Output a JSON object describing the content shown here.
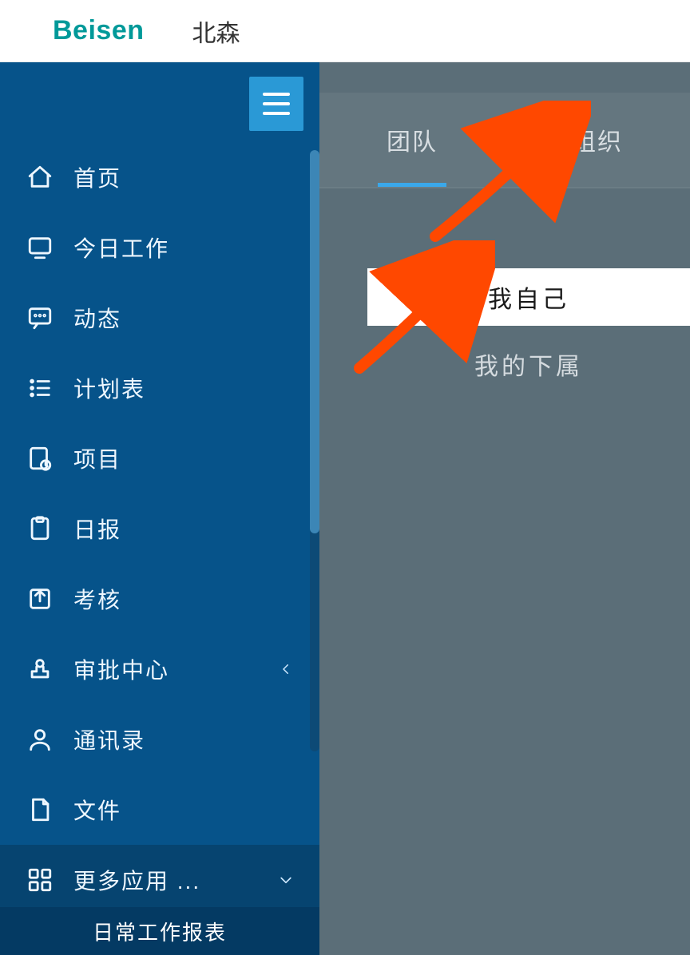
{
  "header": {
    "logo": "Beisen",
    "name": "北森"
  },
  "sidebar": {
    "items": [
      {
        "icon": "home-icon",
        "label": "首页"
      },
      {
        "icon": "monitor-icon",
        "label": "今日工作"
      },
      {
        "icon": "chat-icon",
        "label": "动态"
      },
      {
        "icon": "list-icon",
        "label": "计划表"
      },
      {
        "icon": "project-icon",
        "label": "项目"
      },
      {
        "icon": "report-icon",
        "label": "日报"
      },
      {
        "icon": "share-icon",
        "label": "考核"
      },
      {
        "icon": "stamp-icon",
        "label": "审批中心",
        "chevron": "left"
      },
      {
        "icon": "person-icon",
        "label": "通讯录"
      },
      {
        "icon": "file-icon",
        "label": "文件"
      },
      {
        "icon": "apps-icon",
        "label": "更多应用 ...",
        "chevron": "down",
        "dark": true
      }
    ],
    "footer": "日常工作报表"
  },
  "tabs": {
    "team": "团队",
    "org": "组织",
    "active": "team"
  },
  "options": {
    "self": "我自己",
    "reports": "我的下属",
    "active": "self"
  }
}
